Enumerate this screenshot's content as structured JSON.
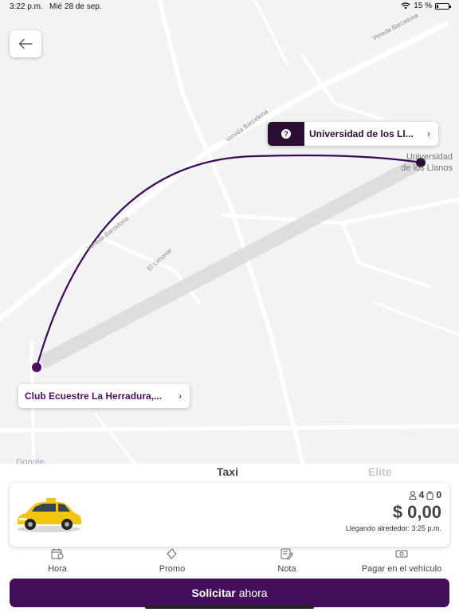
{
  "status": {
    "time": "3:22 p.m.",
    "date": "Mié 28 de sep.",
    "battery": "15 %",
    "battery_level": 0.15
  },
  "map": {
    "roads": [
      "Vereda Barcelona",
      "Vereda Barcelona",
      "Vereda Barcelona",
      "El Limonar"
    ],
    "destination_place": [
      "Universidad",
      "de los Llanos"
    ],
    "attribution": "Google"
  },
  "destination": {
    "label": "Universidad de los Ll...",
    "badge": "?"
  },
  "origin": {
    "label": "Club Ecuestre La Herradura,..."
  },
  "service_tabs": [
    "Taxi",
    "Elite"
  ],
  "vehicle": {
    "passengers": "4",
    "luggage": "0",
    "price": "$ 0,00",
    "eta": "Llegando alrededor: 3:25 p.m."
  },
  "options": [
    {
      "label": "Hora",
      "icon": "calendar-clock-icon"
    },
    {
      "label": "Promo",
      "icon": "ticket-icon"
    },
    {
      "label": "Nota",
      "icon": "note-icon"
    },
    {
      "label": "Pagar en el vehículo",
      "icon": "cash-icon"
    }
  ],
  "request": {
    "bold": "Solicitar",
    "rest": "ahora"
  },
  "colors": {
    "primary": "#440e5b",
    "route": "#3a0a55",
    "badge": "#2b0d33"
  }
}
